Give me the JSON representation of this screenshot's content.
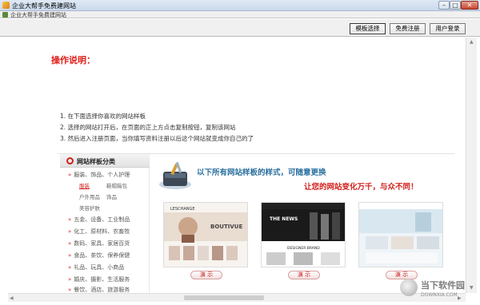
{
  "window": {
    "title": "企业大帮手免费建网站",
    "minimize": "–",
    "maximize": "□",
    "close": "✕"
  },
  "navbar": {
    "text": "企业大帮手免费建网站"
  },
  "toolbar": {
    "buttons": [
      {
        "label": "模板选择"
      },
      {
        "label": "免费注册"
      },
      {
        "label": "用户登录"
      }
    ]
  },
  "instructions": {
    "title": "操作说明：",
    "steps": [
      "1. 在下面选择你喜欢的网站样板",
      "2. 选择的网站打开后，在页面的正上方点击复制按钮，复制该网站",
      "3. 然后进入注册页面，当你填写资料注册以后这个网站就变成你自己的了"
    ]
  },
  "sidebar": {
    "heading": "网站样板分类",
    "categories": [
      {
        "label": "服装、饰品、个人护理",
        "subs": [
          "服装",
          "鞋帽箱包",
          "户外用品",
          "饰品",
          "美容护肤"
        ]
      },
      {
        "label": "五金、设备、工业制品"
      },
      {
        "label": "化工、原材料、农畜牧"
      },
      {
        "label": "数码、家具、家居百货"
      },
      {
        "label": "食品、茶饮、保养保健"
      },
      {
        "label": "礼品、玩具、小商品"
      },
      {
        "label": "婚庆、摄影、生活服务"
      },
      {
        "label": "餐饮、酒店、旅游服务"
      }
    ]
  },
  "banner": {
    "line1": "以下所有网站样板的样式，可随意更换",
    "line2": "让您的网站变化万千，与众不同！"
  },
  "templates": [
    {
      "brand": "LESCHANGE",
      "headline": "BOUTIVUE",
      "demo_label": "演 示"
    },
    {
      "brand": "THE NEWS",
      "headline": "DESIGNER BRAND",
      "demo_label": "演 示"
    },
    {
      "brand": "",
      "headline": "",
      "demo_label": "演 示"
    }
  ],
  "watermark": {
    "text": "当下软件园",
    "url": "DOWNXIA.COM"
  },
  "colors": {
    "accent": "#e0201a",
    "banner_blue": "#2a6f9e",
    "chrome": "#f0f0f0"
  }
}
